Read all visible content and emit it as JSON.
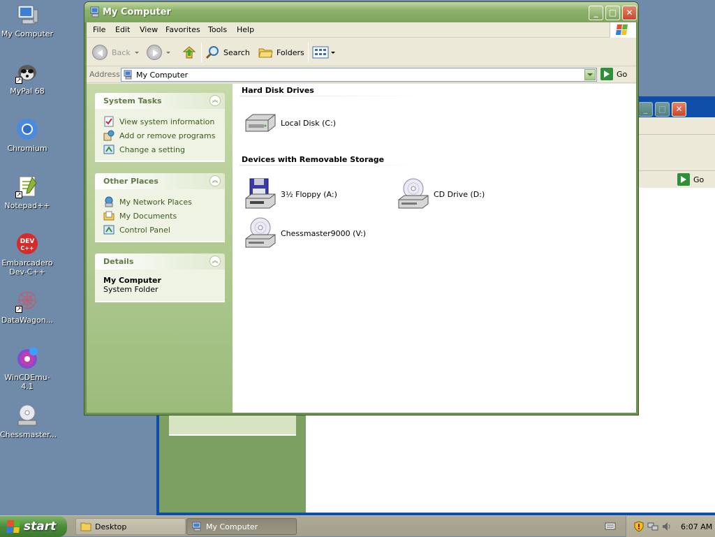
{
  "desktop": {
    "icons": [
      {
        "label": "My Computer"
      },
      {
        "label": "MyPal 68"
      },
      {
        "label": "Chromium"
      },
      {
        "label": "Notepad++"
      },
      {
        "label": "Embarcadero Dev-C++"
      },
      {
        "label": "DataWagon..."
      },
      {
        "label": "WinCDEmu-4.1"
      },
      {
        "label": "Chessmaster..."
      }
    ]
  },
  "window": {
    "title": "My Computer",
    "menu": [
      "File",
      "Edit",
      "View",
      "Favorites",
      "Tools",
      "Help"
    ],
    "toolbar": {
      "back": "Back",
      "search": "Search",
      "folders": "Folders"
    },
    "address": {
      "label": "Address",
      "value": "My Computer",
      "go": "Go"
    },
    "left_pane": {
      "system_tasks": {
        "title": "System Tasks",
        "items": [
          "View system information",
          "Add or remove programs",
          "Change a setting"
        ]
      },
      "other_places": {
        "title": "Other Places",
        "items": [
          "My Network Places",
          "My Documents",
          "Control Panel"
        ]
      },
      "details": {
        "title": "Details",
        "name": "My Computer",
        "type": "System Folder"
      }
    },
    "content": {
      "hard_disk_group": {
        "title": "Hard Disk Drives",
        "drives": [
          "Local Disk (C:)"
        ]
      },
      "removable_group": {
        "title": "Devices with Removable Storage",
        "drives": [
          "3½ Floppy (A:)",
          "CD Drive (D:)",
          "Chessmaster9000 (V:)"
        ]
      }
    }
  },
  "background_window": {
    "go": "Go"
  },
  "taskbar": {
    "start": "start",
    "buttons": [
      "Desktop",
      "My Computer"
    ],
    "clock": "6:07 AM"
  },
  "colors": {
    "desktop": "#6f8ba9",
    "titlebar": "#8db26b",
    "left_pane": "#c6d9a9",
    "taskbar": "#ada997"
  }
}
